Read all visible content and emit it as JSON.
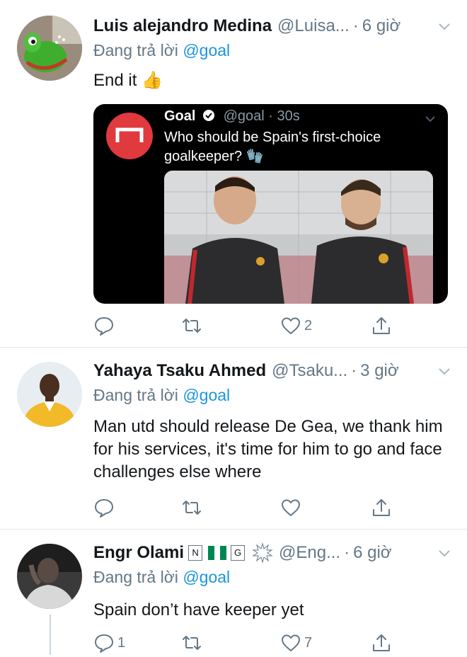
{
  "tweets": [
    {
      "name": "Luis alejandro Medina",
      "handle": "@Luisa...",
      "time": "6 giờ",
      "reply_prefix": "Đang trả lời",
      "reply_to": "@goal",
      "text": "End it 👍",
      "avatar_icon": "frog-plush-avatar",
      "quote": {
        "name": "Goal",
        "handle": "@goal · 30s",
        "text": "Who should be Spain's first-choice goalkeeper? 🧤",
        "verified": true
      },
      "actions": {
        "reply": "",
        "retweet": "",
        "like": "2"
      }
    },
    {
      "name": "Yahaya Tsaku Ahmed",
      "handle": "@Tsaku...",
      "time": "3 giờ",
      "reply_prefix": "Đang trả lời",
      "reply_to": "@goal",
      "text": "Man utd should release De Gea, we thank him for his services, it's time for him to go and face challenges else where",
      "avatar_icon": "man-yellow-shirt-avatar",
      "actions": {
        "reply": "",
        "retweet": "",
        "like": ""
      }
    },
    {
      "name": "Engr Olami",
      "badge_n": "N",
      "badge_g": "G",
      "handle": "@Eng...",
      "time": "6 giờ",
      "reply_prefix": "Đang trả lời",
      "reply_to": "@goal",
      "text": "Spain don’t have keeper yet",
      "avatar_icon": "man-black-white-avatar",
      "actions": {
        "reply": "1",
        "retweet": "",
        "like": "7"
      }
    }
  ],
  "separator": "·",
  "colors": {
    "link": "#1b95e0",
    "secondary": "#657786",
    "divider": "#e1e8ed",
    "goal_red": "#e0393e"
  }
}
